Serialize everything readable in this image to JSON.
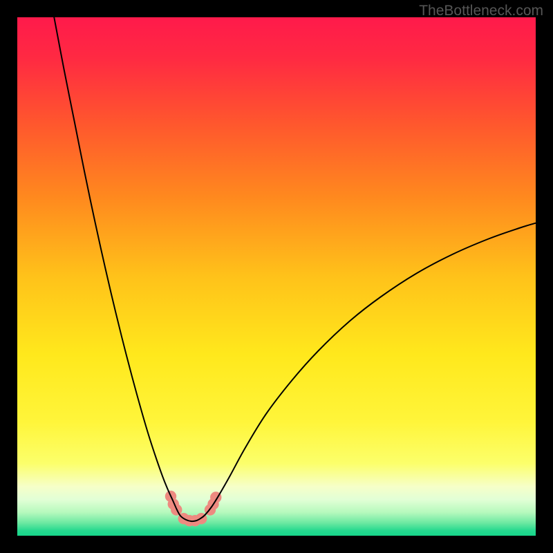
{
  "watermark": "TheBottleneck.com",
  "chart_data": {
    "type": "line",
    "title": "",
    "xlabel": "",
    "ylabel": "",
    "xlim": [
      0,
      100
    ],
    "ylim": [
      0,
      100
    ],
    "grid": false,
    "background_gradient": {
      "stops": [
        {
          "offset": 0.0,
          "color": "#ff1a4b"
        },
        {
          "offset": 0.08,
          "color": "#ff2a42"
        },
        {
          "offset": 0.2,
          "color": "#ff552e"
        },
        {
          "offset": 0.35,
          "color": "#ff8a1e"
        },
        {
          "offset": 0.5,
          "color": "#ffc21a"
        },
        {
          "offset": 0.65,
          "color": "#ffe81c"
        },
        {
          "offset": 0.78,
          "color": "#fff53a"
        },
        {
          "offset": 0.86,
          "color": "#fcff6a"
        },
        {
          "offset": 0.905,
          "color": "#f6ffc8"
        },
        {
          "offset": 0.93,
          "color": "#e2ffd6"
        },
        {
          "offset": 0.955,
          "color": "#b6f9bd"
        },
        {
          "offset": 0.975,
          "color": "#6de9a2"
        },
        {
          "offset": 0.99,
          "color": "#26d98f"
        },
        {
          "offset": 1.0,
          "color": "#17d58a"
        }
      ]
    },
    "series": [
      {
        "name": "left-branch",
        "color": "#000000",
        "width": 2.0,
        "x": [
          7.1,
          9,
          11,
          13,
          15,
          17,
          19,
          21,
          23,
          25,
          26.5,
          28,
          29,
          30,
          30.8,
          31.5
        ],
        "y": [
          100,
          90,
          80,
          70,
          60.5,
          51.5,
          43,
          35,
          27.5,
          20.5,
          15.8,
          11.5,
          9,
          6.8,
          5.0,
          3.8
        ]
      },
      {
        "name": "valley-floor",
        "color": "#000000",
        "width": 2.0,
        "x": [
          31.5,
          32.5,
          33.5,
          34.5,
          35.3,
          36.2
        ],
        "y": [
          3.8,
          3.1,
          2.8,
          2.9,
          3.3,
          4.0
        ]
      },
      {
        "name": "right-branch",
        "color": "#000000",
        "width": 2.0,
        "x": [
          36.2,
          37.5,
          39,
          41,
          44,
          48,
          53,
          58,
          64,
          70,
          77,
          84,
          91,
          97,
          100
        ],
        "y": [
          4.0,
          5.6,
          8.0,
          11.5,
          17,
          23.5,
          30,
          35.6,
          41.3,
          46,
          50.6,
          54.3,
          57.3,
          59.4,
          60.3
        ]
      }
    ],
    "markers": {
      "name": "highlight-dots",
      "color": "#ed8a80",
      "radius": 8.2,
      "points": [
        {
          "x": 29.6,
          "y": 7.6
        },
        {
          "x": 30.1,
          "y": 6.1
        },
        {
          "x": 30.7,
          "y": 5.0
        },
        {
          "x": 32.1,
          "y": 3.3
        },
        {
          "x": 33.2,
          "y": 2.9
        },
        {
          "x": 34.3,
          "y": 2.9
        },
        {
          "x": 35.5,
          "y": 3.3
        },
        {
          "x": 37.2,
          "y": 5.0
        },
        {
          "x": 37.8,
          "y": 6.1
        },
        {
          "x": 38.3,
          "y": 7.4
        }
      ]
    }
  }
}
